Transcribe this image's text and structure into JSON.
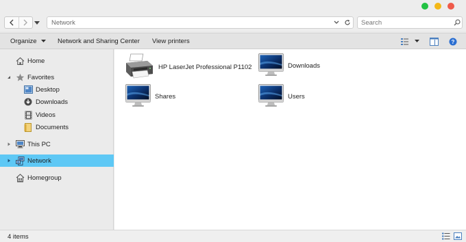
{
  "window": {
    "controls": [
      {
        "name": "maximize",
        "color": "#22c244"
      },
      {
        "name": "minimize",
        "color": "#f4b817"
      },
      {
        "name": "close",
        "color": "#ef5a4a"
      }
    ]
  },
  "address": {
    "path": "Network"
  },
  "search": {
    "placeholder": "Search"
  },
  "commands": {
    "organize": "Organize",
    "network_sharing": "Network and Sharing Center",
    "view_printers": "View printers"
  },
  "sidebar": {
    "items": [
      {
        "label": "Home",
        "icon": "home-icon"
      },
      {
        "label": "Favorites",
        "icon": "star-icon"
      },
      {
        "label": "Desktop",
        "icon": "desktop-icon"
      },
      {
        "label": "Downloads",
        "icon": "download-icon"
      },
      {
        "label": "Videos",
        "icon": "film-icon"
      },
      {
        "label": "Documents",
        "icon": "folder-icon"
      },
      {
        "label": "This PC",
        "icon": "computer-icon"
      },
      {
        "label": "Network",
        "icon": "network-icon",
        "selected": true
      },
      {
        "label": "Homegroup",
        "icon": "homegroup-icon"
      }
    ]
  },
  "content": {
    "items": [
      {
        "label": "HP LaserJet Professional P1102",
        "icon": "printer-icon"
      },
      {
        "label": "Downloads",
        "icon": "monitor-icon"
      },
      {
        "label": "Shares",
        "icon": "monitor-icon"
      },
      {
        "label": "Users",
        "icon": "monitor-icon"
      }
    ]
  },
  "status": {
    "count": "4 items"
  },
  "colors": {
    "selection": "#5ec8f5",
    "accent": "#1e6fd0"
  }
}
